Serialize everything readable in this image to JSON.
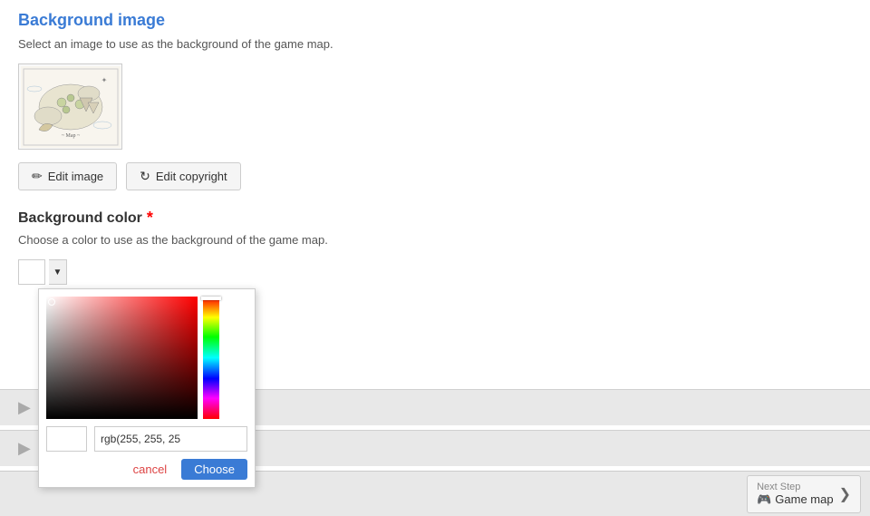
{
  "page": {
    "title": "Background image",
    "description": "Select an image to use as the background of the game map."
  },
  "buttons": {
    "edit_image": "Edit image",
    "edit_copyright": "Edit copyright"
  },
  "bg_color": {
    "title": "Background color",
    "required": true,
    "description": "Choose a color to use as the background of the game map."
  },
  "color_picker": {
    "rgb_value": "rgb(255, 255, 25",
    "cancel_label": "cancel",
    "choose_label": "Choose"
  },
  "next_step": {
    "label": "Next Step",
    "name": "Game map"
  },
  "icons": {
    "edit": "✏",
    "copyright": "↻",
    "gamepad": "🎮",
    "chevron": "❯"
  }
}
